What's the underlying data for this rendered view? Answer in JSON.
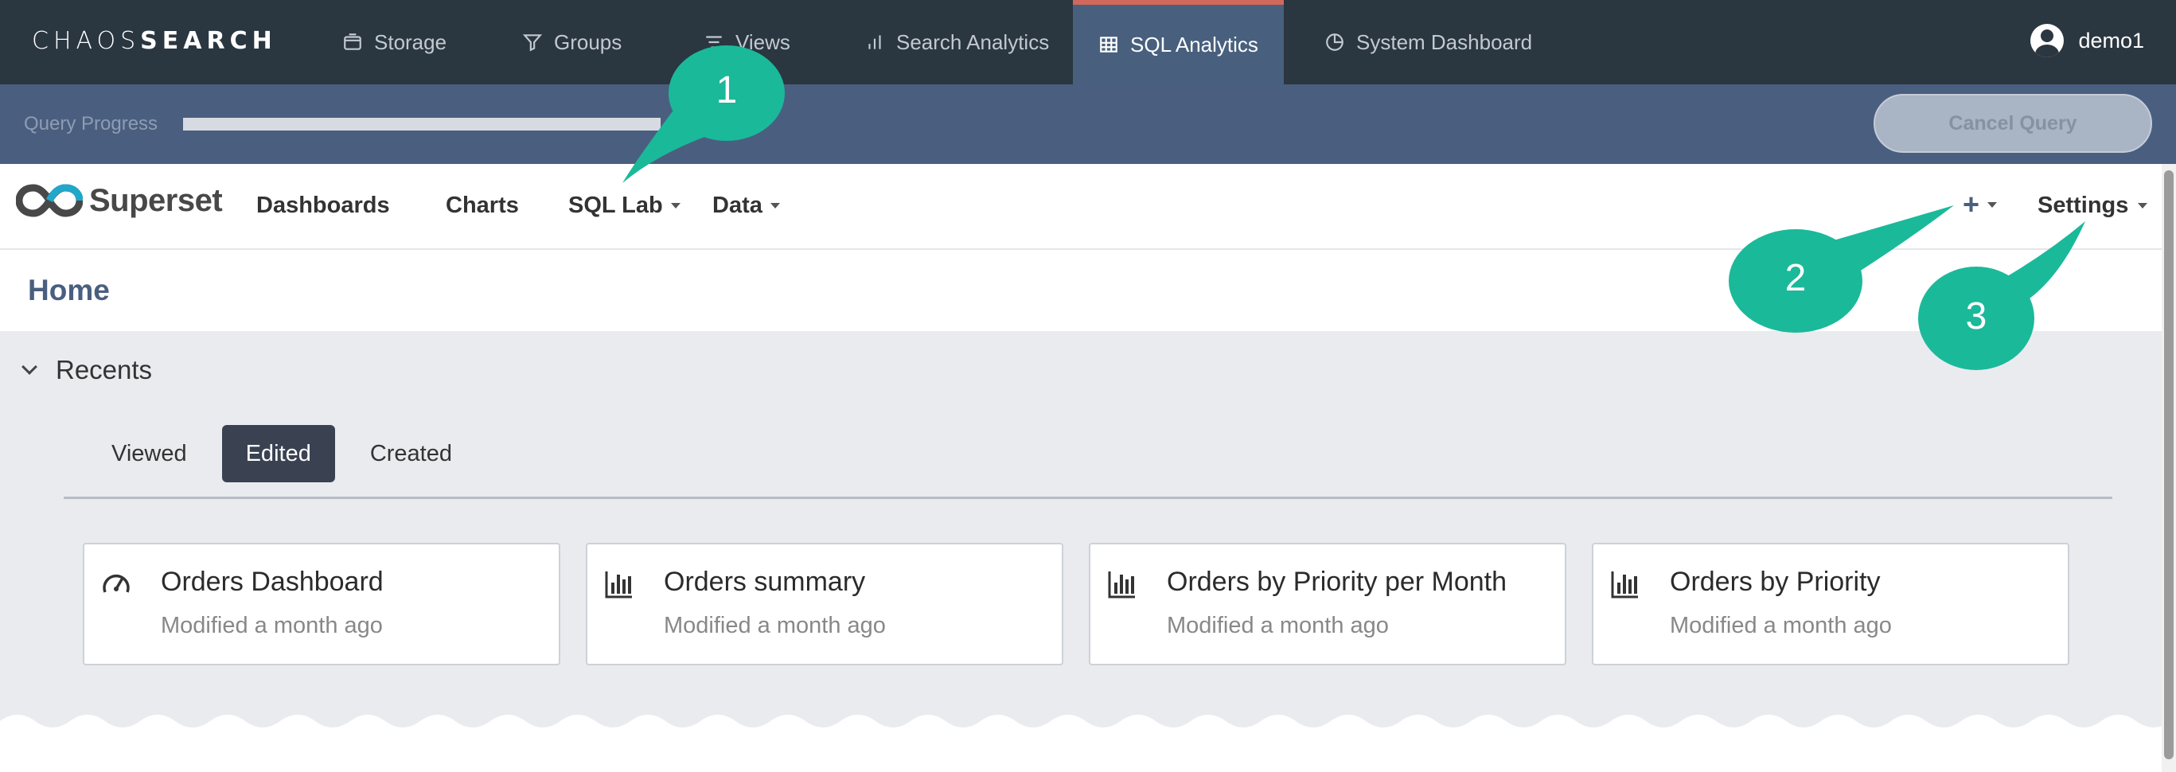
{
  "topnav": {
    "brand_light": "CHAOS",
    "brand_bold": "SEARCH",
    "items": [
      {
        "label": "Storage",
        "icon": "storage-icon"
      },
      {
        "label": "Groups",
        "icon": "filter-icon"
      },
      {
        "label": "Views",
        "icon": "list-icon"
      },
      {
        "label": "Search Analytics",
        "icon": "bar-chart-icon"
      },
      {
        "label": "SQL Analytics",
        "icon": "table-icon",
        "active": true
      },
      {
        "label": "System Dashboard",
        "icon": "pie-chart-icon"
      }
    ],
    "user": "demo1"
  },
  "querybar": {
    "label": "Query Progress",
    "cancel_label": "Cancel Query"
  },
  "superset": {
    "logo_text": "Superset",
    "nav": [
      "Dashboards",
      "Charts",
      "SQL Lab",
      "Data"
    ],
    "plus": "+",
    "settings": "Settings"
  },
  "home": {
    "title": "Home"
  },
  "recents": {
    "title": "Recents",
    "tabs": [
      "Viewed",
      "Edited",
      "Created"
    ],
    "active_tab": "Edited",
    "cards": [
      {
        "title": "Orders Dashboard",
        "subtitle": "Modified a month ago",
        "icon": "dashboard-gauge-icon"
      },
      {
        "title": "Orders summary",
        "subtitle": "Modified a month ago",
        "icon": "bar-chart-icon"
      },
      {
        "title": "Orders by Priority per Month",
        "subtitle": "Modified a month ago",
        "icon": "bar-chart-icon"
      },
      {
        "title": "Orders by Priority",
        "subtitle": "Modified a month ago",
        "icon": "bar-chart-icon"
      }
    ]
  },
  "callouts": [
    "1",
    "2",
    "3"
  ],
  "colors": {
    "topnav_bg": "#2a3640",
    "active_tab_bg": "#48607e",
    "active_tab_accent": "#d0685c",
    "querybar_bg": "#4a5f7f",
    "callout": "#1ab99a",
    "content_bg": "#e9ebef"
  }
}
